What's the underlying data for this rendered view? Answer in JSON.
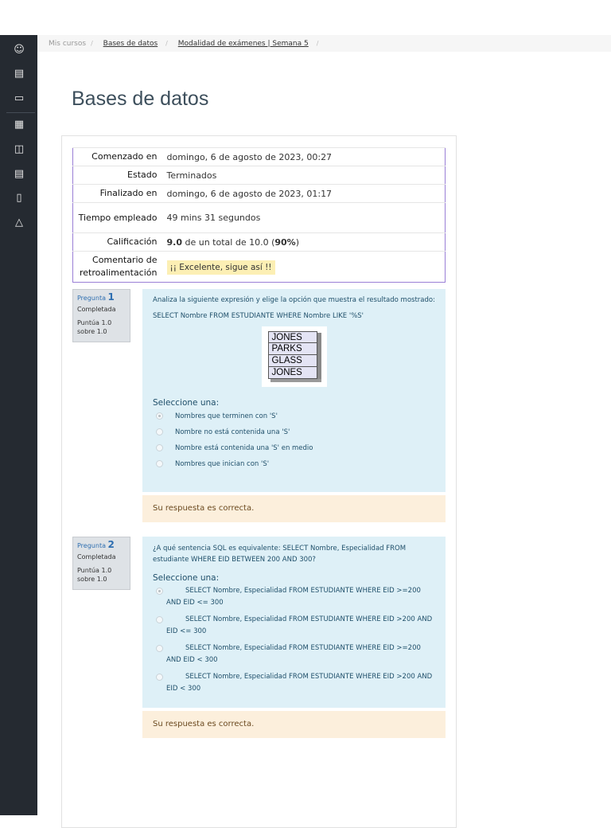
{
  "breadcrumb": [
    "Mis cursos",
    "Bases de datos",
    "Modalidad de exámenes | Semana 5"
  ],
  "page_title": "Bases de datos",
  "sidebar_icons": [
    "user-icon",
    "book-icon",
    "folder-icon",
    "calendar-icon",
    "documents-icon",
    "book-icon",
    "mobile-icon",
    "graduation-cap-icon"
  ],
  "summary": {
    "rows": [
      {
        "label": "Comenzado en",
        "value": "domingo, 6 de agosto de 2023, 00:27"
      },
      {
        "label": "Estado",
        "value": "Terminados"
      },
      {
        "label": "Finalizado en",
        "value": "domingo, 6 de agosto de 2023, 01:17"
      },
      {
        "label": "Tiempo empleado",
        "value": "49 mins 31 segundos"
      }
    ],
    "grade_label": "Calificación",
    "grade": "9.0",
    "grade_total": "de un total de 10.0 (",
    "grade_pct": "90%",
    "grade_close": ")",
    "feedback_label": "Comentario de retroalimentación",
    "feedback": "¡¡ Excelente, sigue así !!"
  },
  "questions": [
    {
      "prefix": "Pregunta",
      "number": "1",
      "state": "Completada",
      "score": "Puntúa 1.0 sobre 1.0",
      "text": "Analiza la siguiente expresión y elige la opción que muestra el resultado mostrado:",
      "code": "SELECT Nombre FROM ESTUDIANTE WHERE Nombre LIKE '%S'",
      "image_rows": [
        "JONES",
        "PARKS",
        "GLASS",
        "JONES"
      ],
      "select_label": "Seleccione una:",
      "options": [
        "Nombres que terminen con 'S'",
        "Nombre no está contenida una 'S'",
        "Nombre está contenida una 'S' en medio",
        "Nombres que inician con 'S'"
      ],
      "feedback": "Su respuesta es correcta."
    },
    {
      "prefix": "Pregunta",
      "number": "2",
      "state": "Completada",
      "score": "Puntúa 1.0 sobre 1.0",
      "text": "¿A qué sentencia SQL es equivalente:  SELECT Nombre, Especialidad FROM estudiante WHERE EID BETWEEN 200 AND 300?",
      "select_label": "Seleccione una:",
      "options": [
        "SELECT Nombre,  Especialidad FROM ESTUDIANTE WHERE EID >=200 AND EID <= 300",
        "SELECT Nombre,  Especialidad FROM ESTUDIANTE WHERE EID >200 AND EID <= 300",
        "SELECT Nombre,  Especialidad FROM ESTUDIANTE WHERE EID >=200 AND EID < 300",
        "SELECT Nombre,  Especialidad FROM ESTUDIANTE WHERE EID >200 AND EID < 300"
      ],
      "feedback": "Su respuesta es correcta."
    }
  ]
}
